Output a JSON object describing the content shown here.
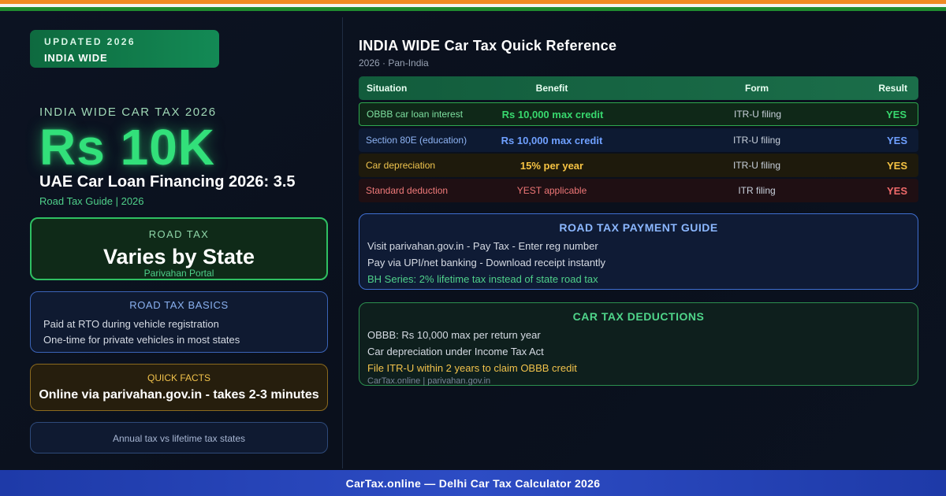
{
  "badge": {
    "line1": "UPDATED 2026",
    "line2": "INDIA WIDE"
  },
  "hero": {
    "eyebrow": "INDIA WIDE CAR TAX 2026",
    "amount": "Rs 10K",
    "headline": "UAE Car Loan Financing 2026: 3.5",
    "subline": "Road Tax Guide | 2026"
  },
  "road_tax_card": {
    "label": "ROAD TAX",
    "value": "Varies by State",
    "note": "Parivahan Portal"
  },
  "basics_card": {
    "title": "ROAD TAX BASICS",
    "lines": [
      "Paid at RTO during vehicle registration",
      "One-time for private vehicles in most states"
    ]
  },
  "facts_card": {
    "title": "QUICK FACTS",
    "value": "Online via parivahan.gov.in - takes 2-3 minutes"
  },
  "annual_card": {
    "text": "Annual tax vs lifetime tax states"
  },
  "reference": {
    "title": "INDIA WIDE Car Tax Quick Reference",
    "subtitle": "2026 · Pan-India",
    "headers": {
      "situation": "Situation",
      "benefit": "Benefit",
      "form": "Form",
      "result": "Result"
    },
    "rows": [
      {
        "situation": "OBBB car loan interest",
        "benefit": "Rs 10,000 max credit",
        "form": "ITR-U filing",
        "result": "YES"
      },
      {
        "situation": "Section 80E (education)",
        "benefit": "Rs 10,000 max credit",
        "form": "ITR-U filing",
        "result": "YES"
      },
      {
        "situation": "Car depreciation",
        "benefit": "15% per year",
        "form": "ITR-U filing",
        "result": "YES"
      },
      {
        "situation": "Standard deduction",
        "benefit": "YEST applicable",
        "form": "ITR filing",
        "result": "YES"
      }
    ]
  },
  "payment_guide": {
    "title": "ROAD TAX PAYMENT GUIDE",
    "lines": [
      "Visit parivahan.gov.in - Pay Tax - Enter reg number",
      "Pay via UPI/net banking - Download receipt instantly",
      "BH Series: 2% lifetime tax instead of state road tax"
    ]
  },
  "deductions": {
    "title": "CAR TAX DEDUCTIONS",
    "lines": [
      "OBBB: Rs 10,000 max per return year",
      "Car depreciation under Income Tax Act",
      "File ITR-U within 2 years to claim OBBB credit"
    ],
    "source": "CarTax.online | parivahan.gov.in"
  },
  "footer": {
    "text": "CarTax.online — Delhi Car Tax Calculator 2026"
  },
  "colors": {
    "saffron": "#f08a24",
    "india_green": "#1f8a2f",
    "hero_green": "#32e07a",
    "accent_blue": "#3f6fd1",
    "accent_gold": "#f1c24b",
    "accent_red": "#ef6a6a",
    "footer_blue": "#2d4cc4"
  }
}
